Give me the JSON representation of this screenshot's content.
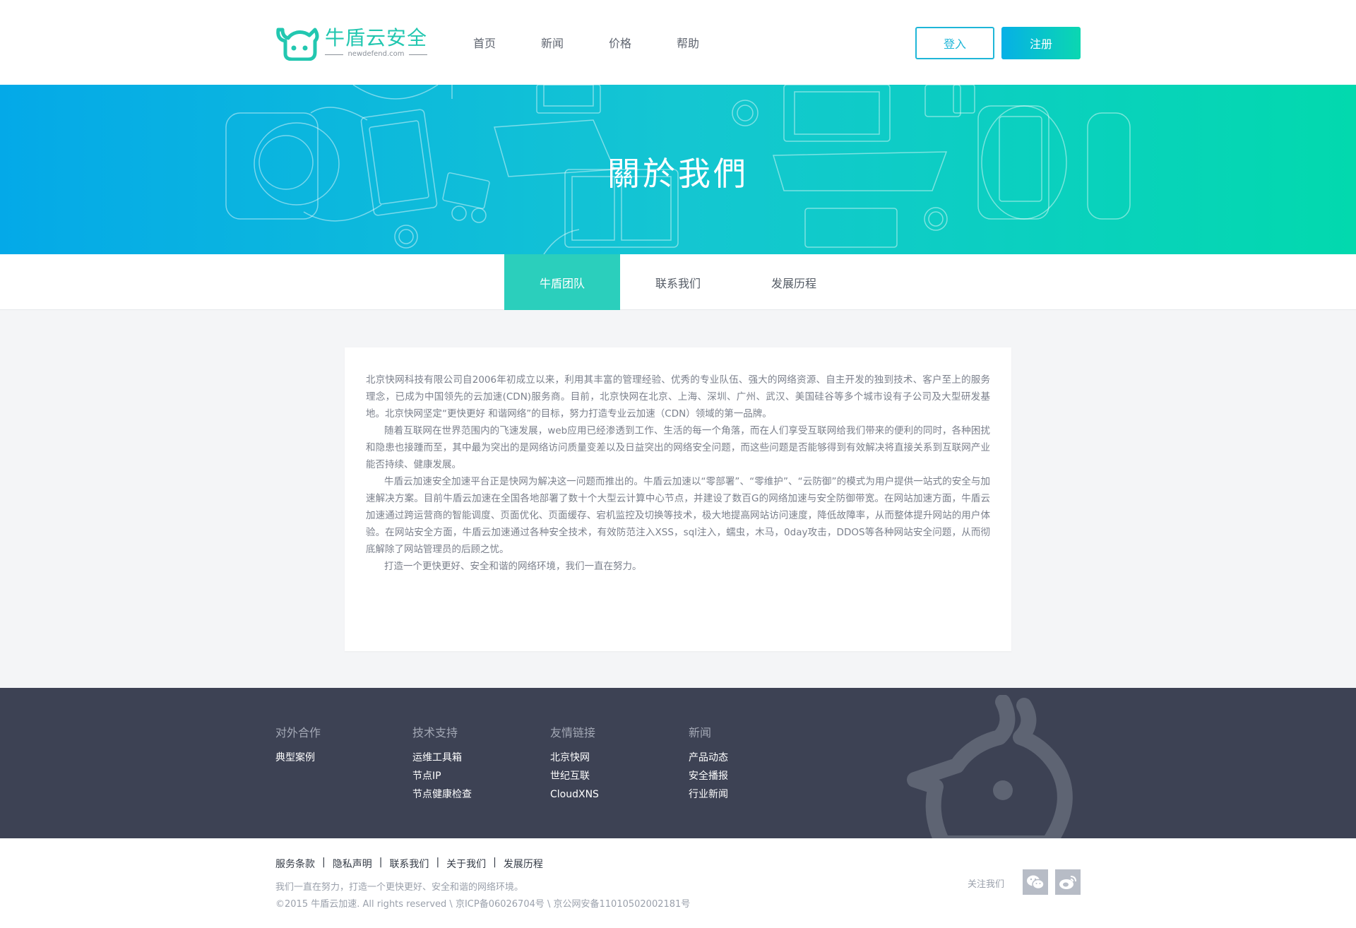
{
  "header": {
    "logo_text": "牛盾云安全",
    "logo_domain": "newdefend.com",
    "nav": [
      "首页",
      "新闻",
      "价格",
      "帮助"
    ],
    "login_label": "登入",
    "register_label": "注册"
  },
  "banner": {
    "title": "關於我們"
  },
  "tabs": [
    "牛盾团队",
    "联系我们",
    "发展历程"
  ],
  "content": {
    "paragraphs": [
      "北京快网科技有限公司自2006年初成立以来，利用其丰富的管理经验、优秀的专业队伍、强大的网络资源、自主开发的独到技术、客户至上的服务理念，已成为中国领先的云加速(CDN)服务商。目前，北京快网在北京、上海、深圳、广州、武汉、美国硅谷等多个城市设有子公司及大型研发基地。北京快网坚定“更快更好 和谐网络”的目标，努力打造专业云加速（CDN）领域的第一品牌。",
      "随着互联网在世界范围内的飞速发展，web应用已经渗透到工作、生活的每一个角落，而在人们享受互联网给我们带来的便利的同时，各种困扰和隐患也接踵而至，其中最为突出的是网络访问质量变差以及日益突出的网络安全问题，而这些问题是否能够得到有效解决将直接关系到互联网产业能否持续、健康发展。",
      "牛盾云加速安全加速平台正是快网为解决这一问题而推出的。牛盾云加速以“零部署”、“零维护”、“云防御”的模式为用户提供一站式的安全与加速解决方案。目前牛盾云加速在全国各地部署了数十个大型云计算中心节点，并建设了数百G的网络加速与安全防御带宽。在网站加速方面，牛盾云加速通过跨运营商的智能调度、页面优化、页面缓存、宕机监控及切换等技术，极大地提高网站访问速度，降低故障率，从而整体提升网站的用户体验。在网站安全方面，牛盾云加速通过各种安全技术，有效防范注入XSS，sql注入，蠕虫，木马，0day攻击，DDOS等各种网站安全问题，从而彻底解除了网站管理员的后顾之忧。",
      "打造一个更快更好、安全和谐的网络环境，我们一直在努力。"
    ]
  },
  "footer": {
    "columns": [
      {
        "title": "对外合作",
        "links": [
          "典型案例"
        ]
      },
      {
        "title": "技术支持",
        "links": [
          "运维工具箱",
          "节点IP",
          "节点健康检查"
        ]
      },
      {
        "title": "友情链接",
        "links": [
          "北京快网",
          "世纪互联",
          "CloudXNS"
        ]
      },
      {
        "title": "新闻",
        "links": [
          "产品动态",
          "安全播报",
          "行业新闻"
        ]
      }
    ]
  },
  "bottom": {
    "links": [
      "服务条款",
      "隐私声明",
      "联系我们",
      "关于我们",
      "发展历程"
    ],
    "separator": "|",
    "slogan": "我们一直在努力，打造一个更快更好、安全和谐的网络环境。",
    "copyright": "©2015 牛盾云加速. All rights reserved \\ 京ICP备06026704号 \\ 京公网安备11010502002181号",
    "follow_label": "关注我们",
    "social_icons": [
      "wechat-icon",
      "weibo-icon"
    ]
  },
  "colors": {
    "accent": "#2bcfbc",
    "brand_blue": "#1fb6d8",
    "footer_bg": "#3d4254"
  }
}
